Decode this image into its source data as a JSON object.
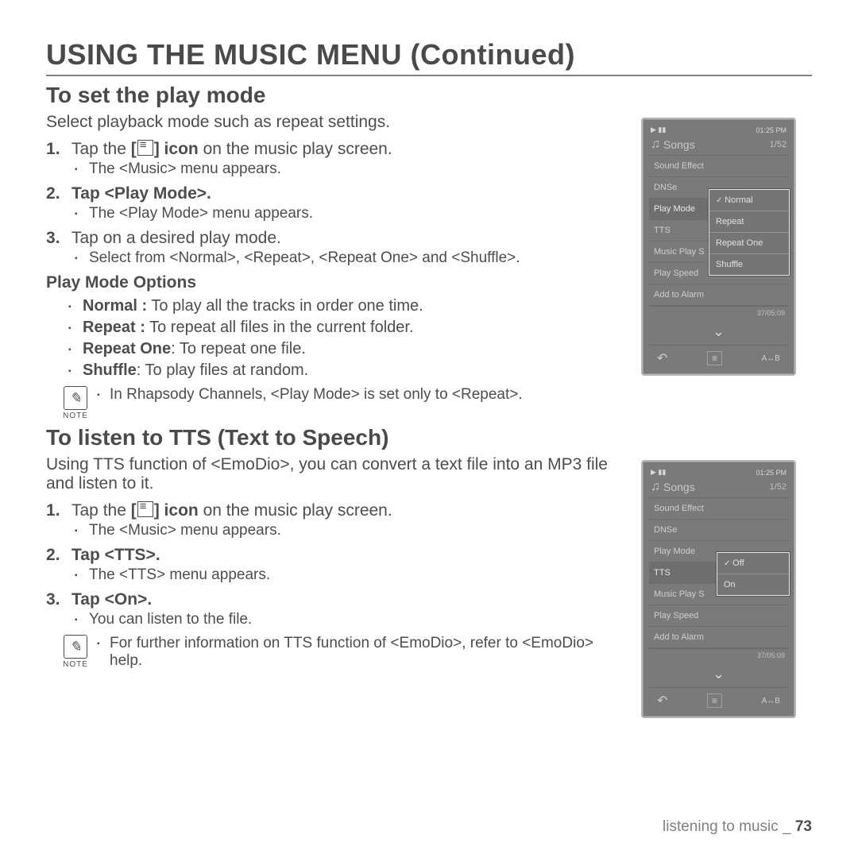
{
  "page_title": "USING THE MUSIC MENU (Continued)",
  "section1": {
    "heading": "To set the play mode",
    "intro": "Select playback mode such as repeat settings.",
    "steps": [
      {
        "pre": "Tap the ",
        "bold": "[   ] icon",
        "post": " on the music play screen.",
        "icon": true,
        "sub": [
          "The <Music> menu appears."
        ]
      },
      {
        "pre": "Tap ",
        "bold": "<Play Mode>",
        "post": ".",
        "sub": [
          "The <Play Mode> menu appears."
        ]
      },
      {
        "pre": "Tap on a desired play mode.",
        "bold": "",
        "post": "",
        "sub": [
          "Select from <Normal>, <Repeat>, <Repeat One> and <Shuffle>."
        ]
      }
    ],
    "opts_heading": "Play Mode Options",
    "opts": [
      {
        "b": "Normal :",
        "t": " To play all the tracks in order one time."
      },
      {
        "b": "Repeat :",
        "t": " To repeat all files in the current folder."
      },
      {
        "b": "Repeat One",
        "t": ": To repeat one file."
      },
      {
        "b": "Shuffle",
        "t": ": To play files at random."
      }
    ],
    "note_label": "NOTE",
    "note": "In Rhapsody Channels, <Play Mode> is set only to <Repeat>."
  },
  "section2": {
    "heading": "To listen to TTS (Text to Speech)",
    "intro": "Using TTS function of <EmoDio>, you can convert a text file into an MP3 file and listen to it.",
    "steps": [
      {
        "pre": "Tap the ",
        "bold": "[   ] icon",
        "post": " on the music play screen.",
        "icon": true,
        "sub": [
          "The <Music> menu appears."
        ]
      },
      {
        "pre": "Tap ",
        "bold": "<TTS>",
        "post": ".",
        "sub": [
          "The <TTS> menu appears."
        ]
      },
      {
        "pre": "Tap ",
        "bold": "<On>",
        "post": ".",
        "sub": [
          "You can listen to the file."
        ]
      }
    ],
    "note_label": "NOTE",
    "note": "For further information on TTS function of <EmoDio>, refer to <EmoDio> help."
  },
  "device1": {
    "time": "01:25 PM",
    "title": "Songs",
    "count": "1/52",
    "menu": [
      "Sound Effect",
      "DNSe",
      "Play Mode",
      "TTS",
      "Music Play S",
      "Play Speed",
      "Add to Alarm"
    ],
    "hl_index": 2,
    "popup": [
      "Normal",
      "Repeat",
      "Repeat One",
      "Shuffle"
    ],
    "popup_sel": 0,
    "track": "37/05:09"
  },
  "device2": {
    "time": "01:25 PM",
    "title": "Songs",
    "count": "1/52",
    "menu": [
      "Sound Effect",
      "DNSe",
      "Play Mode",
      "TTS",
      "Music Play S",
      "Play Speed",
      "Add to Alarm"
    ],
    "hl_index": 3,
    "popup": [
      "Off",
      "On"
    ],
    "popup_sel": 0,
    "track": "37/05:09"
  },
  "footer": {
    "text": "listening to music _ ",
    "page": "73"
  }
}
